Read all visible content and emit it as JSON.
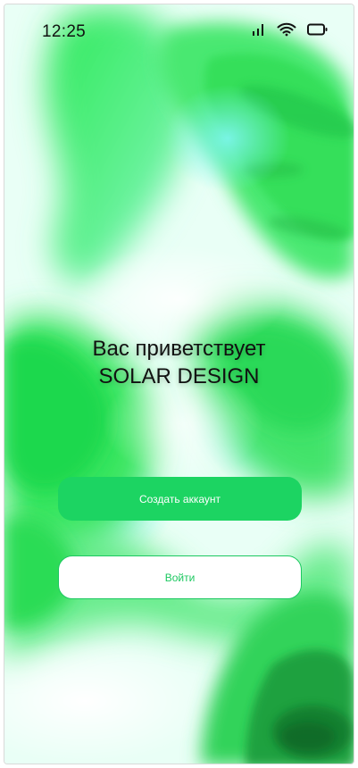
{
  "status_bar": {
    "time": "12:25",
    "icons": [
      "signal-icon",
      "wifi-icon",
      "battery-icon"
    ]
  },
  "welcome": {
    "line1": "Вас приветствует",
    "line2": "SOLAR DESIGN"
  },
  "actions": {
    "create_account_label": "Создать аккаунт",
    "login_label": "Войти"
  },
  "colors": {
    "accent": "#1cd462",
    "accent_text": "#1cc860",
    "background_green": "#3fe860",
    "background_cyan": "#5df2f0"
  }
}
